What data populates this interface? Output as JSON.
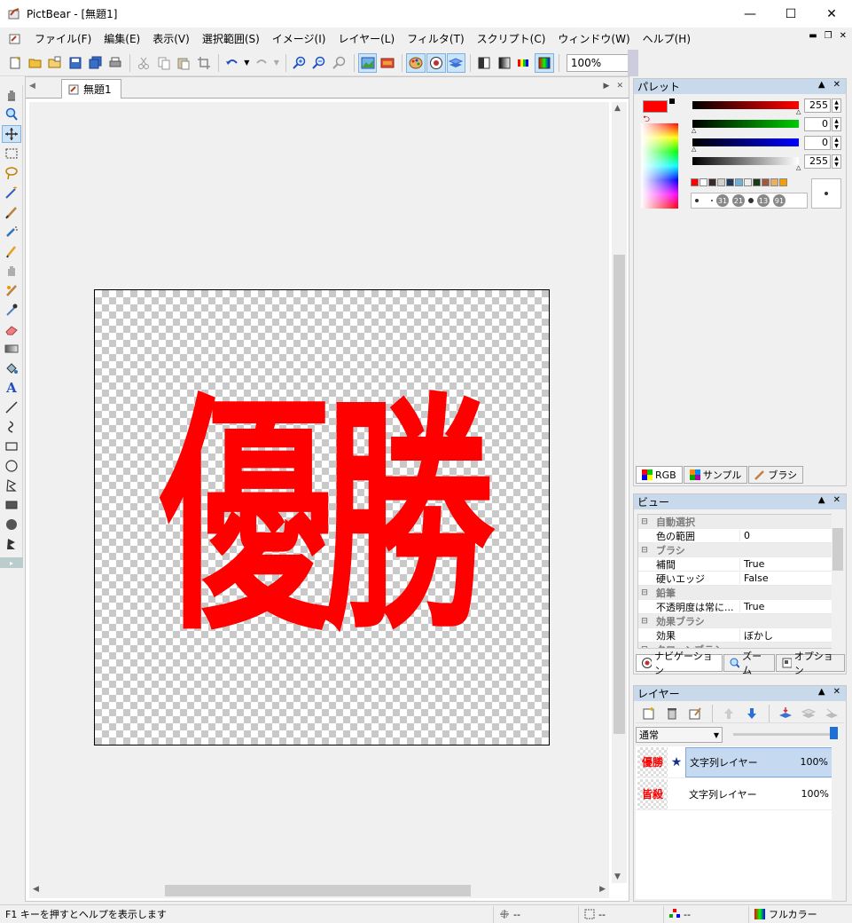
{
  "window": {
    "title": "PictBear - [無題1]",
    "minimize_glyph": "—",
    "maximize_glyph": "☐",
    "close_glyph": "✕"
  },
  "menu": {
    "items": [
      "ファイル(F)",
      "編集(E)",
      "表示(V)",
      "選択範囲(S)",
      "イメージ(I)",
      "レイヤー(L)",
      "フィルタ(T)",
      "スクリプト(C)",
      "ウィンドウ(W)",
      "ヘルプ(H)"
    ]
  },
  "toolbar": {
    "zoom": "100%"
  },
  "document": {
    "tab_label": "無題1",
    "canvas_text": "優勝"
  },
  "palette": {
    "title": "パレット",
    "rgba": {
      "r": "255",
      "g": "0",
      "b": "0",
      "a": "255"
    },
    "brush_sizes": [
      "31",
      "21",
      "13",
      "91"
    ],
    "tabs": [
      "RGB",
      "サンプル",
      "ブラシ"
    ],
    "swatch_colors": [
      "#ff0000",
      "#ffffff",
      "#3a2a2a",
      "#cfcfcf",
      "#1f3a5a",
      "#6ab0d8",
      "#eeeeee",
      "#1a3a1a",
      "#a05a3a",
      "#e8b060",
      "#f0a000"
    ]
  },
  "view": {
    "title": "ビュー",
    "rows": [
      {
        "type": "cat",
        "name": "自動選択"
      },
      {
        "type": "prop",
        "name": "色の範囲",
        "value": "0"
      },
      {
        "type": "cat",
        "name": "ブラシ"
      },
      {
        "type": "prop",
        "name": "補間",
        "value": "True"
      },
      {
        "type": "prop",
        "name": "硬いエッジ",
        "value": "False"
      },
      {
        "type": "cat",
        "name": "鉛筆"
      },
      {
        "type": "prop",
        "name": "不透明度は常に...",
        "value": "True"
      },
      {
        "type": "cat",
        "name": "効果ブラシ"
      },
      {
        "type": "prop",
        "name": "効果",
        "value": "ぼかし"
      },
      {
        "type": "cat",
        "name": "クローンブラシ"
      }
    ],
    "tabs": [
      "ナビゲーション",
      "ズーム",
      "オプション"
    ]
  },
  "layers": {
    "title": "レイヤー",
    "blend_mode": "通常",
    "opacity": 1.0,
    "items": [
      {
        "thumb": "優勝",
        "name": "文字列レイヤー",
        "opacity": "100%",
        "selected": true,
        "star": "★"
      },
      {
        "thumb": "皆殺",
        "name": "文字列レイヤー",
        "opacity": "100%",
        "selected": false,
        "star": ""
      }
    ]
  },
  "status": {
    "message": "F1 キーを押すとヘルプを表示します",
    "pos": "--",
    "size": "--",
    "color": "--",
    "mode": "フルカラー"
  },
  "colors": {
    "accent": "#ff0000",
    "selection": "#c5d9f1",
    "panel_header": "#c7d9ea"
  }
}
